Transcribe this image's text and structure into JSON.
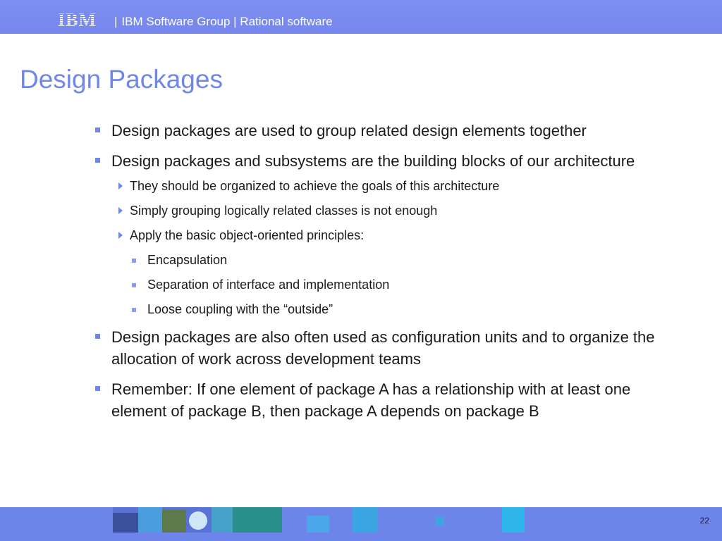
{
  "header": {
    "logo_text": "IBM",
    "separator": "|",
    "title": "IBM Software Group | Rational software"
  },
  "slide": {
    "title": "Design Packages",
    "bullets": [
      "Design packages are used to group related design elements together",
      "Design packages and subsystems are the building blocks of our architecture",
      "Design packages are also often used as configuration units and to organize the allocation of work across development teams",
      "Remember: If one element of package A has a relationship with at least one element of package B, then package A depends on package B"
    ],
    "sub_bullets": [
      "They should be organized to achieve the goals of this architecture",
      "Simply grouping logically related classes is not enough",
      "Apply the basic object-oriented principles:"
    ],
    "sub_sub_bullets": [
      "Encapsulation",
      "Separation of interface and implementation",
      "Loose coupling with the “outside”"
    ]
  },
  "footer": {
    "page_number": "22"
  },
  "colors": {
    "header_bar": "#7586ee",
    "title": "#6f86ea",
    "bullet": "#6f86ea",
    "footer_bar": "#6d85eb"
  }
}
